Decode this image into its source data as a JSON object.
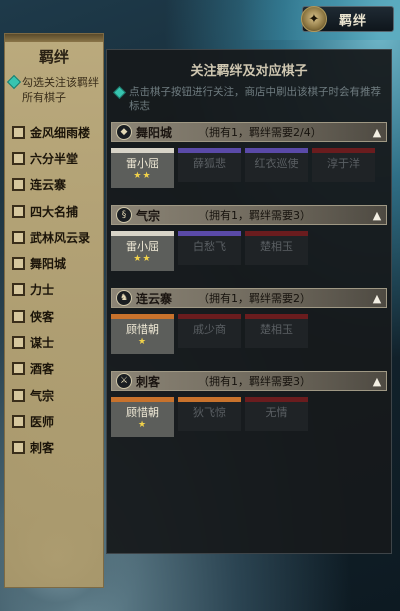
{
  "top_badge": {
    "label": "羁绊"
  },
  "left_panel": {
    "title": "羁绊",
    "hint": "勾选关注该羁绊所有棋子",
    "bonds": [
      "金风细雨楼",
      "六分半堂",
      "连云寨",
      "四大名捕",
      "武林风云录",
      "舞阳城",
      "力士",
      "侠客",
      "谋士",
      "酒客",
      "气宗",
      "医师",
      "刺客"
    ]
  },
  "right_panel": {
    "title": "关注羁绊及对应棋子",
    "hint": "点击棋子按钮进行关注，商店中刷出该棋子时会有推荐标志",
    "groups": [
      {
        "name": "舞阳城",
        "status": "（拥有1，羁绊需要2/4）",
        "icon": "diamond",
        "chess": [
          {
            "name": "雷小屈",
            "owned": true,
            "stars": "★★",
            "bar": "#d8d4c8"
          },
          {
            "name": "薛狐悲",
            "owned": false,
            "stars": "",
            "bar": "#5a4aa8"
          },
          {
            "name": "红衣巡使",
            "owned": false,
            "stars": "",
            "bar": "#5a4aa8"
          },
          {
            "name": "淳于洋",
            "owned": false,
            "stars": "",
            "bar": "#6a1c1e"
          }
        ]
      },
      {
        "name": "气宗",
        "status": "（拥有1，羁绊需要3）",
        "icon": "swirl",
        "chess": [
          {
            "name": "雷小屈",
            "owned": true,
            "stars": "★★",
            "bar": "#d8d4c8"
          },
          {
            "name": "白愁飞",
            "owned": false,
            "stars": "",
            "bar": "#5a4aa8"
          },
          {
            "name": "楚相玉",
            "owned": false,
            "stars": "",
            "bar": "#6a1c1e"
          }
        ]
      },
      {
        "name": "连云寨",
        "status": "（拥有1，羁绊需要2）",
        "icon": "flame",
        "chess": [
          {
            "name": "顾惜朝",
            "owned": true,
            "stars": "★",
            "bar": "#c8722c"
          },
          {
            "name": "戚少商",
            "owned": false,
            "stars": "",
            "bar": "#6a1c1e"
          },
          {
            "name": "楚相玉",
            "owned": false,
            "stars": "",
            "bar": "#6a1c1e"
          }
        ]
      },
      {
        "name": "刺客",
        "status": "（拥有1，羁绊需要3）",
        "icon": "blade",
        "chess": [
          {
            "name": "顾惜朝",
            "owned": true,
            "stars": "★",
            "bar": "#c8722c"
          },
          {
            "name": "狄飞惊",
            "owned": false,
            "stars": "",
            "bar": "#c8722c"
          },
          {
            "name": "无情",
            "owned": false,
            "stars": "",
            "bar": "#6a1c1e"
          }
        ]
      }
    ]
  }
}
